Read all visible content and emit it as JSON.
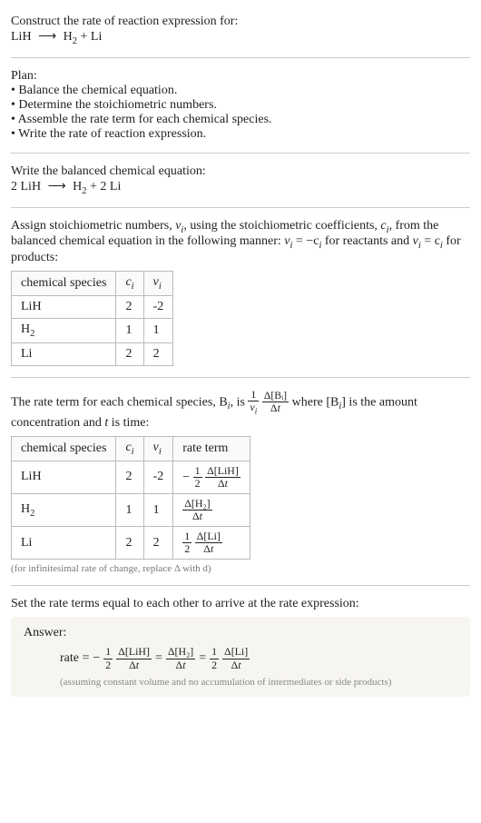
{
  "header": {
    "title": "Construct the rate of reaction expression for:",
    "equation_lhs": "LiH",
    "equation_arrow": "⟶",
    "equation_rhs": "H",
    "equation_rhs_sub": "2",
    "equation_rhs2": " + Li"
  },
  "plan": {
    "title": "Plan:",
    "items": [
      "Balance the chemical equation.",
      "Determine the stoichiometric numbers.",
      "Assemble the rate term for each chemical species.",
      "Write the rate of reaction expression."
    ]
  },
  "balanced": {
    "title": "Write the balanced chemical equation:",
    "lhs": "2 LiH",
    "arrow": "⟶",
    "rhs1": "H",
    "rhs1_sub": "2",
    "rhs2": " + 2 Li"
  },
  "stoich": {
    "intro_a": "Assign stoichiometric numbers, ",
    "nu_i": "ν",
    "nu_i_sub": "i",
    "intro_b": ", using the stoichiometric coefficients, ",
    "c_i": "c",
    "c_i_sub": "i",
    "intro_c": ", from the balanced chemical equation in the following manner: ",
    "rel1_a": "ν",
    "rel1_sub": "i",
    "rel1_b": " = −c",
    "rel1_b_sub": "i",
    "rel1_c": " for reactants and ",
    "rel2_a": "ν",
    "rel2_sub": "i",
    "rel2_b": " = c",
    "rel2_b_sub": "i",
    "rel2_c": " for products:",
    "table": {
      "headers": [
        "chemical species",
        "cᵢ",
        "νᵢ"
      ],
      "rows": [
        {
          "species": "LiH",
          "c": "2",
          "nu": "-2"
        },
        {
          "species": "H",
          "species_sub": "2",
          "c": "1",
          "nu": "1"
        },
        {
          "species": "Li",
          "c": "2",
          "nu": "2"
        }
      ]
    }
  },
  "rateterm": {
    "intro_a": "The rate term for each chemical species, B",
    "intro_a_sub": "i",
    "intro_b": ", is ",
    "frac1_num": "1",
    "frac1_den_a": "ν",
    "frac1_den_sub": "i",
    "frac2_num": "Δ[Bᵢ]",
    "frac2_den": "Δt",
    "intro_c": " where [B",
    "intro_c_sub": "i",
    "intro_d": "] is the amount concentration and ",
    "t": "t",
    "intro_e": " is time:",
    "table": {
      "headers": [
        "chemical species",
        "cᵢ",
        "νᵢ",
        "rate term"
      ],
      "rows": [
        {
          "species": "LiH",
          "c": "2",
          "nu": "-2",
          "rate_sign": "−",
          "rate_coef_num": "1",
          "rate_coef_den": "2",
          "rate_num": "Δ[LiH]",
          "rate_den": "Δt"
        },
        {
          "species": "H",
          "species_sub": "2",
          "c": "1",
          "nu": "1",
          "rate_sign": "",
          "rate_coef_num": "",
          "rate_coef_den": "",
          "rate_num": "Δ[H₂]",
          "rate_den": "Δt"
        },
        {
          "species": "Li",
          "c": "2",
          "nu": "2",
          "rate_sign": "",
          "rate_coef_num": "1",
          "rate_coef_den": "2",
          "rate_num": "Δ[Li]",
          "rate_den": "Δt"
        }
      ]
    },
    "note": "(for infinitesimal rate of change, replace Δ with d)"
  },
  "final": {
    "title": "Set the rate terms equal to each other to arrive at the rate expression:",
    "answer_label": "Answer:",
    "rate_label": "rate = ",
    "term1_sign": "−",
    "term1_coef_num": "1",
    "term1_coef_den": "2",
    "term1_num": "Δ[LiH]",
    "term1_den": "Δt",
    "eq": " = ",
    "term2_num": "Δ[H₂]",
    "term2_den": "Δt",
    "term3_coef_num": "1",
    "term3_coef_den": "2",
    "term3_num": "Δ[Li]",
    "term3_den": "Δt",
    "note": "(assuming constant volume and no accumulation of intermediates or side products)"
  }
}
